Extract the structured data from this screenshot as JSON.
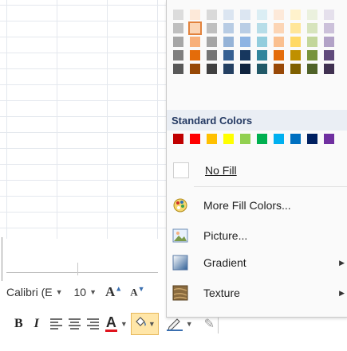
{
  "menu": {
    "theme_shades": [
      [
        "#dcdcdc",
        "#bfbfbf",
        "#a6a6a6",
        "#7f7f7f",
        "#595959"
      ],
      [
        "#fde9d9",
        "#fbd5b5",
        "#f8b07a",
        "#e46c0a",
        "#974806"
      ],
      [
        "#d9d9d9",
        "#bfbfbf",
        "#a5a5a5",
        "#757575",
        "#404040"
      ],
      [
        "#dbe5f1",
        "#b8cce4",
        "#95b3d7",
        "#366092",
        "#244062"
      ],
      [
        "#dce6f2",
        "#b9cde5",
        "#8eb4e3",
        "#17375e",
        "#10243f"
      ],
      [
        "#dbeef4",
        "#b7dde8",
        "#93cddd",
        "#31859c",
        "#215968"
      ],
      [
        "#fde9d9",
        "#fcd5b5",
        "#fac090",
        "#e46c0a",
        "#984807"
      ],
      [
        "#fff2cc",
        "#ffe699",
        "#ffd966",
        "#bf9000",
        "#7f6000"
      ],
      [
        "#ebf1de",
        "#d7e4bd",
        "#c3d69b",
        "#77933c",
        "#4f6228"
      ],
      [
        "#e5e0ec",
        "#ccc1da",
        "#b2a2c7",
        "#604a7b",
        "#403151"
      ]
    ],
    "selected_swatch": "#fbd5b5",
    "standard_colors_header": "Standard Colors",
    "standard_colors": [
      "#c00000",
      "#ff0000",
      "#ffc000",
      "#ffff00",
      "#92d050",
      "#00b050",
      "#00b0f0",
      "#0070c0",
      "#002060",
      "#7030a0"
    ],
    "no_fill": "No Fill",
    "more_fill_colors": "More Fill Colors...",
    "picture": "Picture...",
    "gradient": "Gradient",
    "texture": "Texture"
  },
  "toolbar": {
    "font_name": "Calibri (E",
    "font_size": "10",
    "grow_font": "A",
    "shrink_font": "A",
    "bold": "B",
    "italic": "I",
    "font_color_letter": "A",
    "font_color": "#e0141e",
    "fill_color_bar": "#ffe6a8"
  }
}
